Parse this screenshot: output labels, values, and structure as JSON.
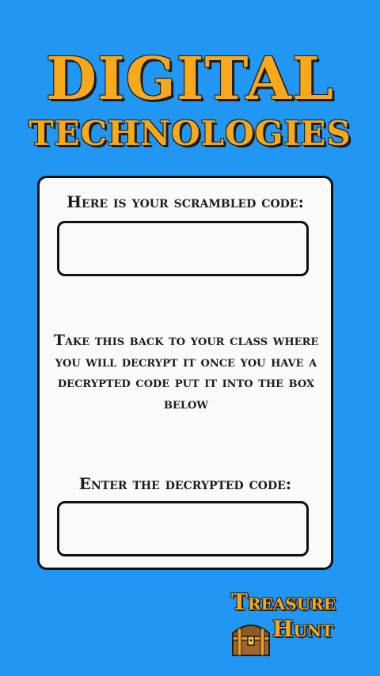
{
  "header": {
    "title_line1": "DIGITAL",
    "title_line2": "TECHNOLOGIES"
  },
  "card": {
    "scrambled_label": "Here is your scrambled code:",
    "scrambled_value": "",
    "instructions": "Take this back to your class where you will decrypt it once you have a decrypted code put it into the box below",
    "decrypted_label": "Enter the decrypted code:",
    "decrypted_value": ""
  },
  "logo": {
    "line1": "Treasure",
    "line2": "Hunt",
    "icon": "treasure-chest-icon"
  },
  "colors": {
    "background": "#2196F3",
    "accent": "#F7A81B",
    "card": "#FAFAF9"
  }
}
